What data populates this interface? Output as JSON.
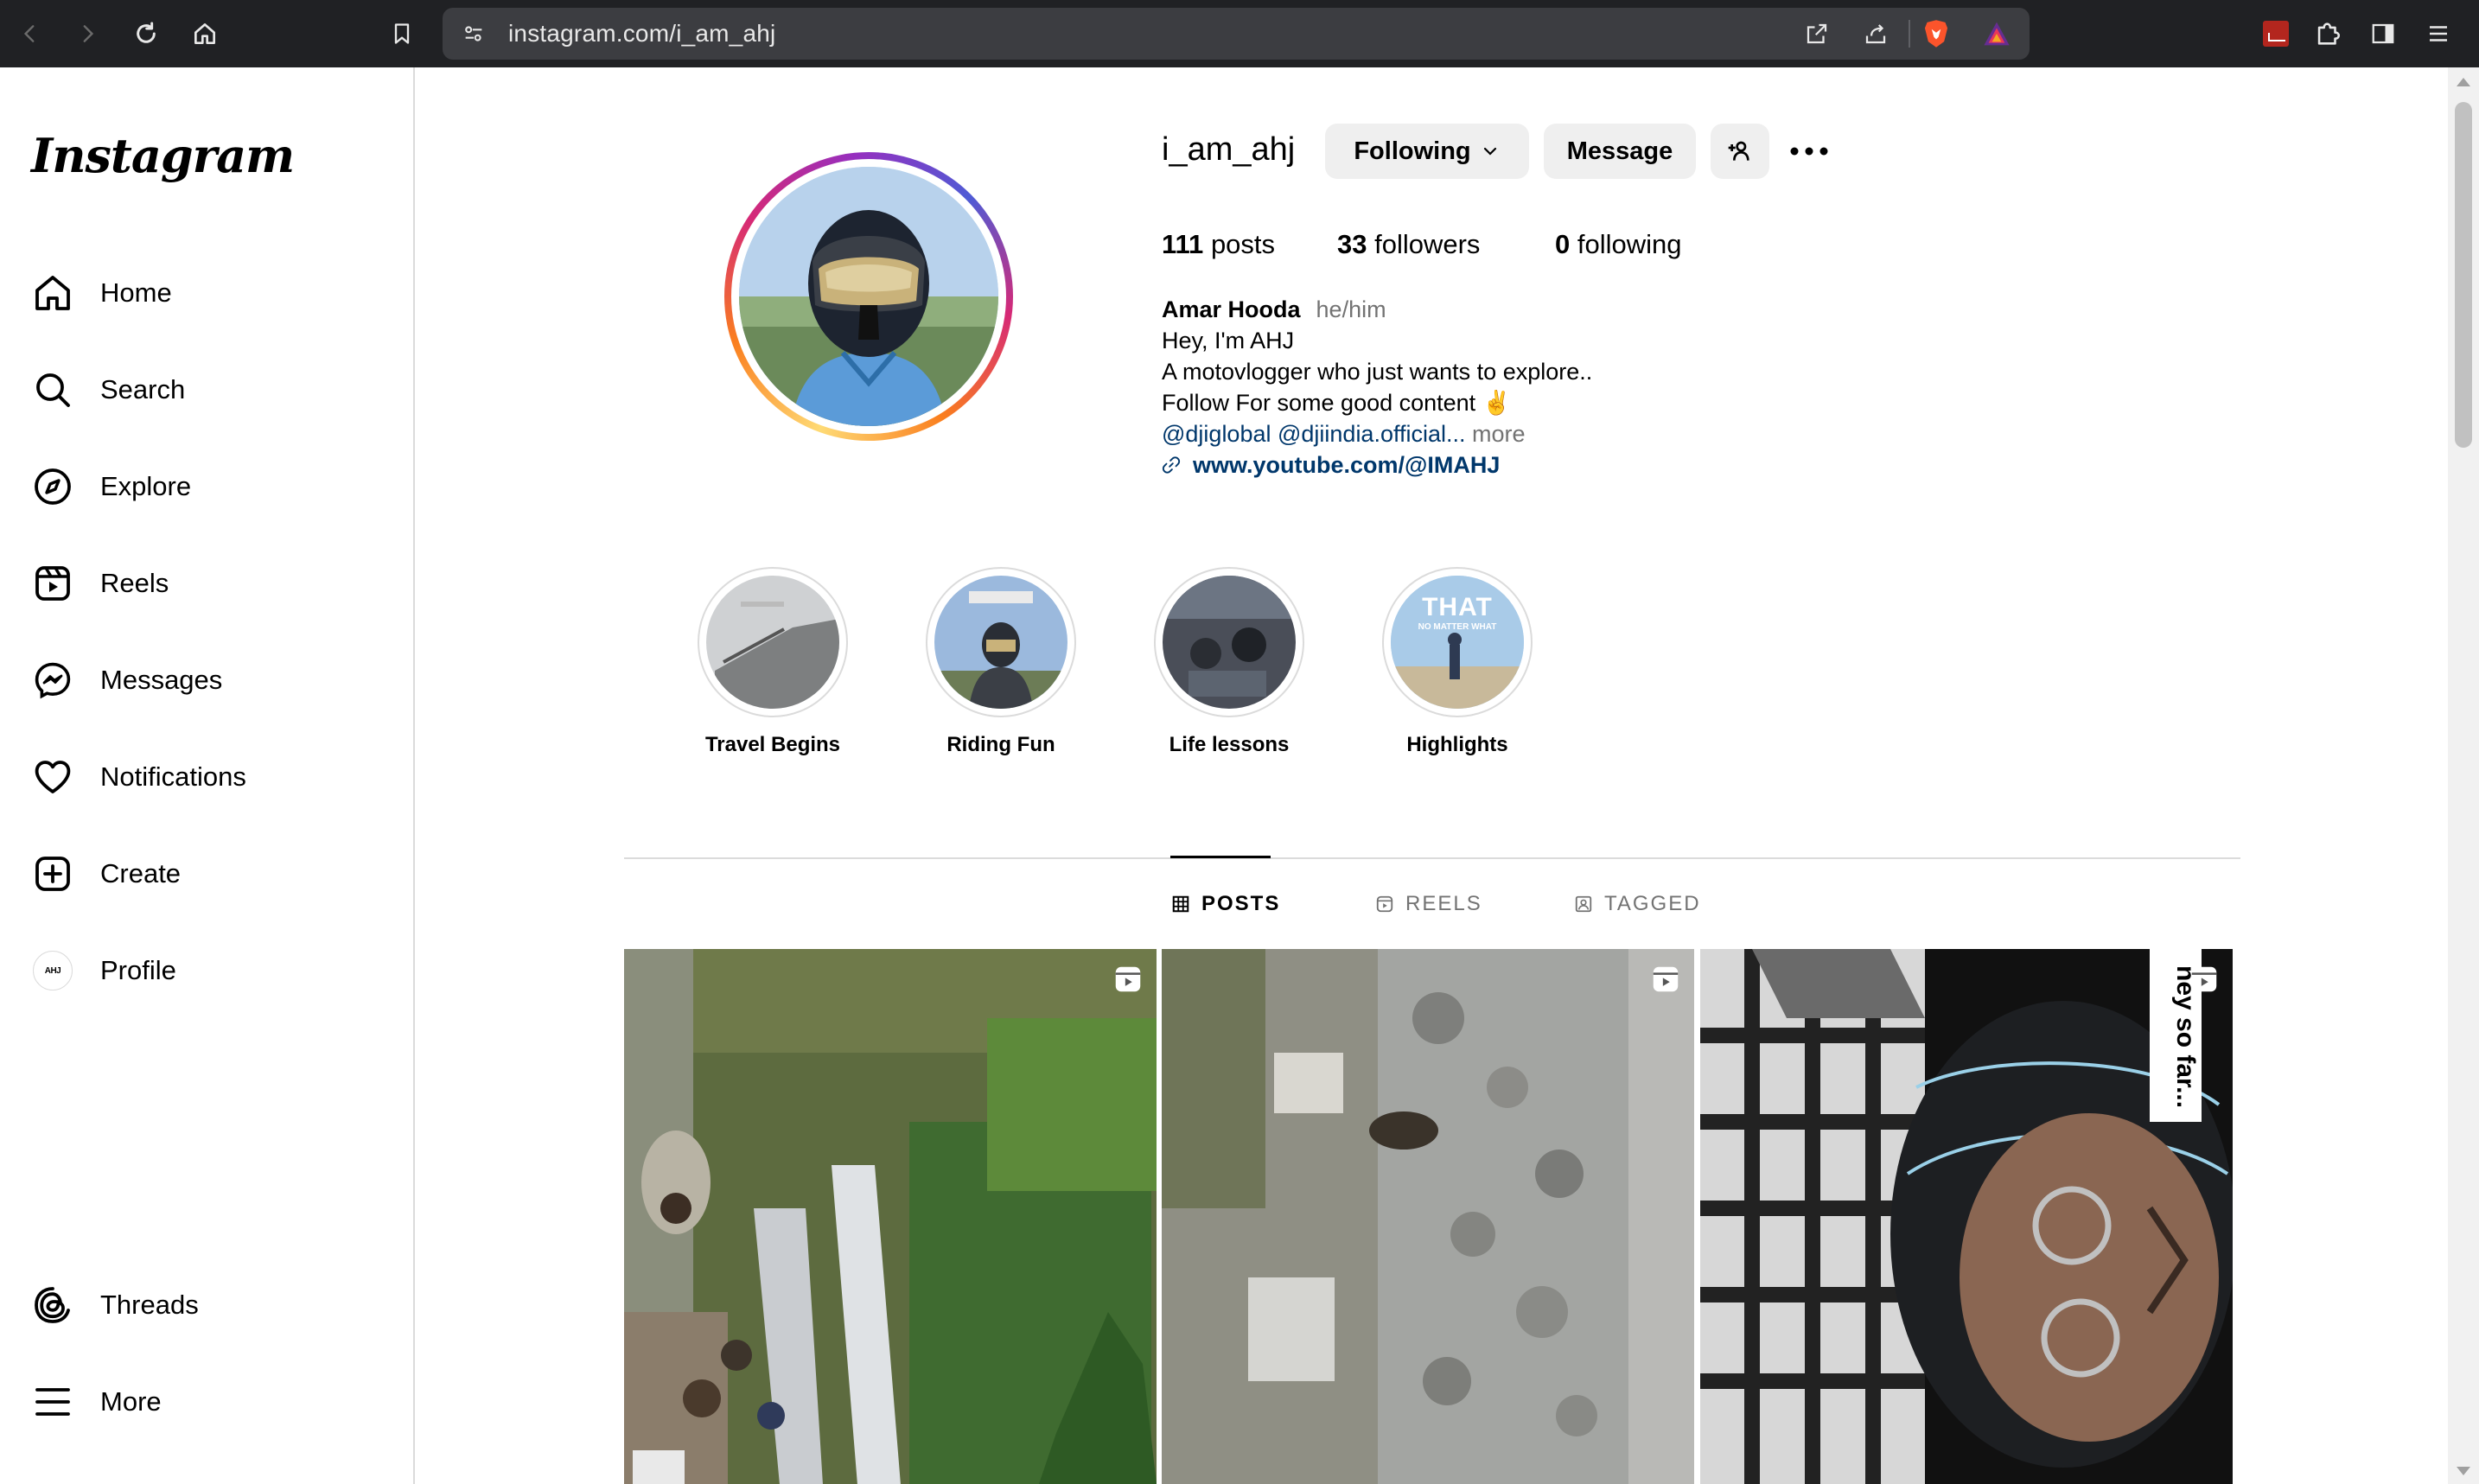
{
  "browser": {
    "url": "instagram.com/i_am_ahj"
  },
  "sidebar": {
    "logo": "Instagram",
    "items": [
      {
        "label": "Home",
        "icon": "home-icon"
      },
      {
        "label": "Search",
        "icon": "search-icon"
      },
      {
        "label": "Explore",
        "icon": "compass-icon"
      },
      {
        "label": "Reels",
        "icon": "reels-icon"
      },
      {
        "label": "Messages",
        "icon": "messenger-icon"
      },
      {
        "label": "Notifications",
        "icon": "heart-icon"
      },
      {
        "label": "Create",
        "icon": "plus-square-icon"
      },
      {
        "label": "Profile",
        "icon": "profile-avatar"
      },
      {
        "label": "Threads",
        "icon": "threads-icon"
      },
      {
        "label": "More",
        "icon": "menu-icon"
      }
    ],
    "profile_avatar_text": "AHJ"
  },
  "profile": {
    "username": "i_am_ahj",
    "following_button": "Following",
    "message_button": "Message",
    "stats": {
      "posts_count": "111",
      "posts_label": "posts",
      "followers_count": "33",
      "followers_label": "followers",
      "following_count": "0",
      "following_label": "following"
    },
    "bio": {
      "name": "Amar Hooda",
      "pronouns": "he/him",
      "line1": "Hey, I'm AHJ",
      "line2": "A motovlogger who just wants to explore..",
      "line3": "Follow For some good content ✌",
      "mentions": "@djiglobal @djiindia.official...",
      "more": "more",
      "link": "www.youtube.com/@IMAHJ"
    }
  },
  "highlights": [
    {
      "label": "Travel Begins"
    },
    {
      "label": "Riding Fun"
    },
    {
      "label": "Life lessons"
    },
    {
      "label": "Highlights",
      "overlay_text": "THAT",
      "overlay_sub": "NO MATTER WHAT"
    }
  ],
  "tabs": {
    "posts": "POSTS",
    "reels": "REELS",
    "tagged": "TAGGED",
    "active": "posts"
  },
  "posts": [
    {
      "type": "reel",
      "overlay_text": ""
    },
    {
      "type": "reel",
      "overlay_text": ""
    },
    {
      "type": "reel",
      "overlay_text": "ney so far..."
    }
  ],
  "colors": {
    "link": "#00376b",
    "secondary_text": "#737373",
    "button_bg": "#efefef",
    "border": "#dbdbdb",
    "browser_bar": "#202124"
  }
}
